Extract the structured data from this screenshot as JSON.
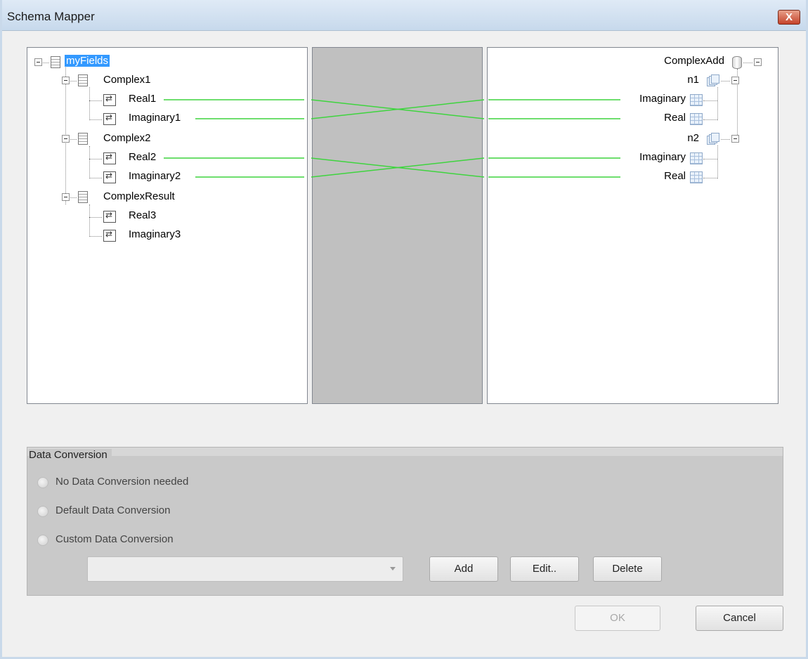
{
  "window": {
    "title": "Schema Mapper",
    "close_symbol": "X"
  },
  "source_tree": {
    "root": "myFields",
    "groups": [
      {
        "label": "Complex1",
        "fields": [
          "Real1",
          "Imaginary1"
        ]
      },
      {
        "label": "Complex2",
        "fields": [
          "Real2",
          "Imaginary2"
        ]
      },
      {
        "label": "ComplexResult",
        "fields": [
          "Real3",
          "Imaginary3"
        ]
      }
    ]
  },
  "target_tree": {
    "root": "ComplexAdd",
    "groups": [
      {
        "label": "n1",
        "fields": [
          "Imaginary",
          "Real"
        ]
      },
      {
        "label": "n2",
        "fields": [
          "Imaginary",
          "Real"
        ]
      }
    ]
  },
  "data_conversion": {
    "title": "Data Conversion",
    "options": [
      "No Data Conversion needed",
      "Default Data Conversion",
      "Custom Data Conversion"
    ],
    "combo_value": "",
    "buttons": {
      "add": "Add",
      "edit": "Edit..",
      "delete": "Delete"
    }
  },
  "footer": {
    "ok": "OK",
    "cancel": "Cancel"
  },
  "colors": {
    "mapping_line": "#3ed43e",
    "selection": "#3399ff"
  }
}
